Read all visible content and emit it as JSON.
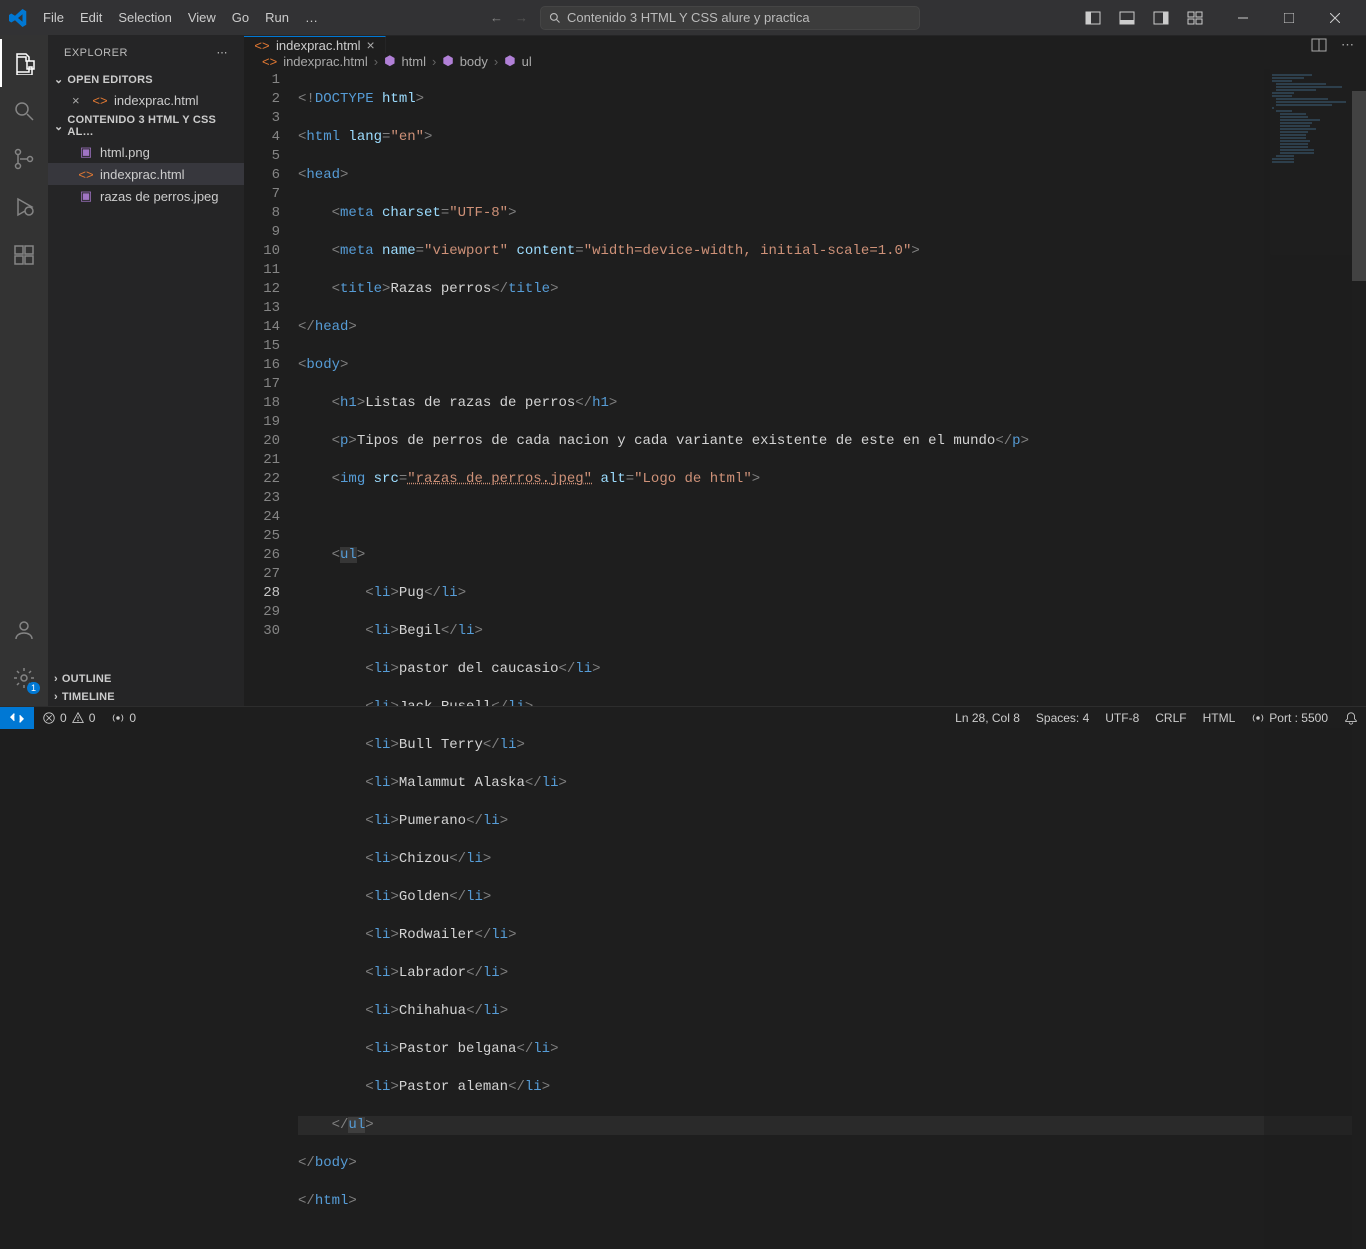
{
  "menu": [
    "File",
    "Edit",
    "Selection",
    "View",
    "Go",
    "Run",
    "…"
  ],
  "search_placeholder": "Contenido 3 HTML Y CSS alure y practica",
  "explorer_title": "EXPLORER",
  "open_editors": "OPEN EDITORS",
  "project_name": "CONTENIDO 3 HTML Y CSS AL…",
  "files": {
    "open_editor": "indexprac.html",
    "htmlpng": "html.png",
    "indexprac": "indexprac.html",
    "razas": "razas de perros.jpeg"
  },
  "outline": "OUTLINE",
  "timeline": "TIMELINE",
  "tab_name": "indexprac.html",
  "breadcrumbs": {
    "file": "indexprac.html",
    "html": "html",
    "body": "body",
    "ul": "ul"
  },
  "status": {
    "errors": "0",
    "warnings": "0",
    "radio": "0",
    "ln_col": "Ln 28, Col 8",
    "spaces": "Spaces: 4",
    "encoding": "UTF-8",
    "eol": "CRLF",
    "lang": "HTML",
    "port": "Port : 5500"
  },
  "code": {
    "l1_a": "<!",
    "l1_b": "DOCTYPE",
    "l1_c": " html",
    "l1_d": ">",
    "l2_a": "<",
    "l2_b": "html",
    "l2_c": " lang",
    "l2_d": "=",
    "l2_e": "\"en\"",
    "l2_f": ">",
    "l3_a": "<",
    "l3_b": "head",
    "l3_c": ">",
    "l4_a": "<",
    "l4_b": "meta",
    "l4_c": " charset",
    "l4_d": "=",
    "l4_e": "\"UTF-8\"",
    "l4_f": ">",
    "l5_a": "<",
    "l5_b": "meta",
    "l5_c": " name",
    "l5_d": "=",
    "l5_e": "\"viewport\"",
    "l5_f": " content",
    "l5_g": "=",
    "l5_h": "\"width=device-width, initial-scale=1.0\"",
    "l5_i": ">",
    "l6_a": "<",
    "l6_b": "title",
    "l6_c": ">",
    "l6_d": "Razas perros",
    "l6_e": "</",
    "l6_f": "title",
    "l6_g": ">",
    "l7_a": "</",
    "l7_b": "head",
    "l7_c": ">",
    "l8_a": "<",
    "l8_b": "body",
    "l8_c": ">",
    "l9_a": "<",
    "l9_b": "h1",
    "l9_c": ">",
    "l9_d": "Listas de razas de perros",
    "l9_e": "</",
    "l9_f": "h1",
    "l9_g": ">",
    "l10_a": "<",
    "l10_b": "p",
    "l10_c": ">",
    "l10_d": "Tipos de perros de cada nacion y cada variante existente de este en el mundo",
    "l10_e": "</",
    "l10_f": "p",
    "l10_g": ">",
    "l11_a": "<",
    "l11_b": "img",
    "l11_c": " src",
    "l11_d": "=",
    "l11_e": "\"razas de perros.jpeg\"",
    "l11_f": " alt",
    "l11_g": "=",
    "l11_h": "\"Logo de html\"",
    "l11_i": ">",
    "l13_a": "<",
    "l13_b": "ul",
    "l13_c": ">",
    "li_open_a": "<",
    "li_open_b": "li",
    "li_open_c": ">",
    "li_close_a": "</",
    "li_close_b": "li",
    "li_close_c": ">",
    "li14": "Pug",
    "li15": "Begil",
    "li16": "pastor del caucasio",
    "li17": "Jack Rusell",
    "li18": "Bull Terry",
    "li19": "Malammut Alaska",
    "li20": "Pumerano",
    "li21": "Chizou",
    "li22": "Golden",
    "li23": "Rodwailer",
    "li24": "Labrador",
    "li25": "Chihahua",
    "li26": "Pastor belgana",
    "li27": "Pastor aleman",
    "l28_a": "</",
    "l28_b": "ul",
    "l28_c": ">",
    "l29_a": "</",
    "l29_b": "body",
    "l29_c": ">",
    "l30_a": "</",
    "l30_b": "html",
    "l30_c": ">"
  }
}
